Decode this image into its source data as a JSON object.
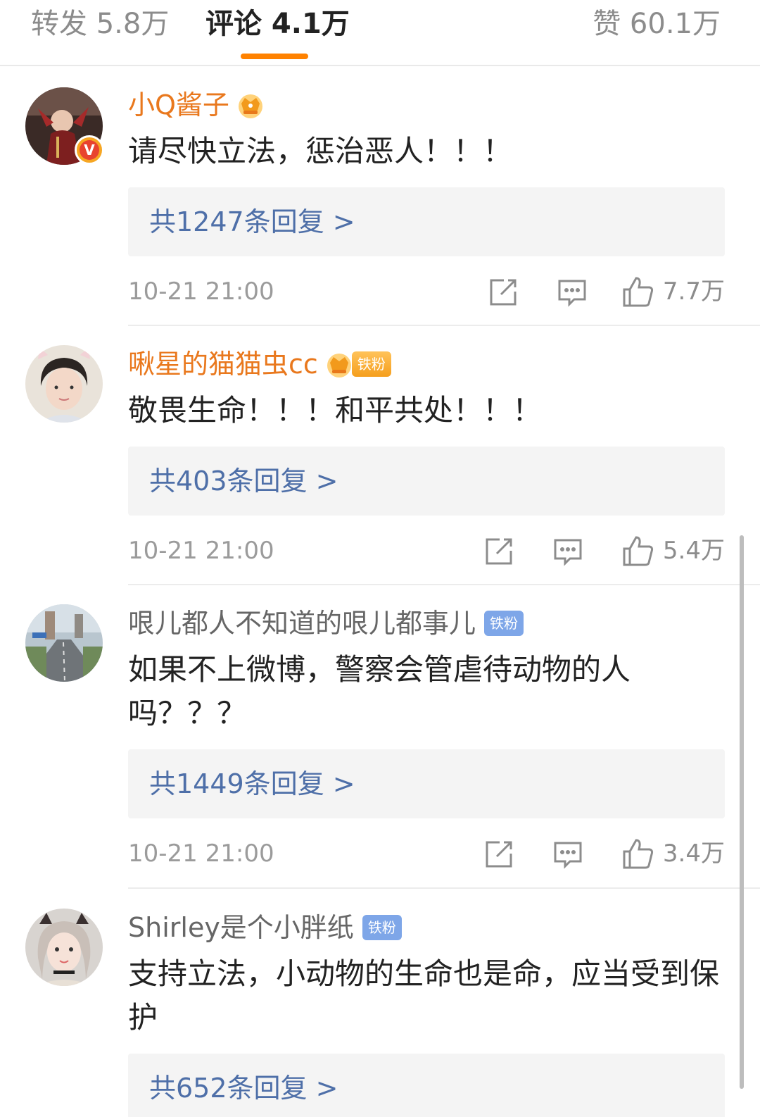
{
  "tabs": {
    "repost": "转发 5.8万",
    "comments": "评论 4.1万",
    "likes": "赞 60.1万",
    "active": "comments"
  },
  "colors": {
    "accent": "#ff8200",
    "vip_name": "#e9781d",
    "link": "#4e6fa8",
    "fan_gold": "#f59f1d",
    "fan_blue": "#7ea6e8"
  },
  "comments": [
    {
      "username": "小Q酱子",
      "badge_icon": "crown-icon",
      "avatar_badge": "V",
      "text": "请尽快立法，惩治恶人！！！",
      "replies": "共1247条回复 >",
      "time": "10-21 21:00",
      "likes": "7.7万"
    },
    {
      "username": "啾星的猫猫虫cc",
      "badge_icon": "crown-icon",
      "fan_badge": "铁粉",
      "text": "敬畏生命！！！和平共处！！！",
      "replies": "共403条回复 >",
      "time": "10-21 21:00",
      "likes": "5.4万"
    },
    {
      "username": "哏儿都人不知道的哏儿都事儿",
      "fan_badge": "铁粉",
      "text": "如果不上微博，警察会管虐待动物的人吗？？？",
      "replies": "共1449条回复 >",
      "time": "10-21 21:00",
      "likes": "3.4万"
    },
    {
      "username": "Shirley是个小胖纸",
      "fan_badge": "铁粉",
      "text": "支持立法，小动物的生命也是命，应当受到保护",
      "replies": "共652条回复 >"
    }
  ]
}
